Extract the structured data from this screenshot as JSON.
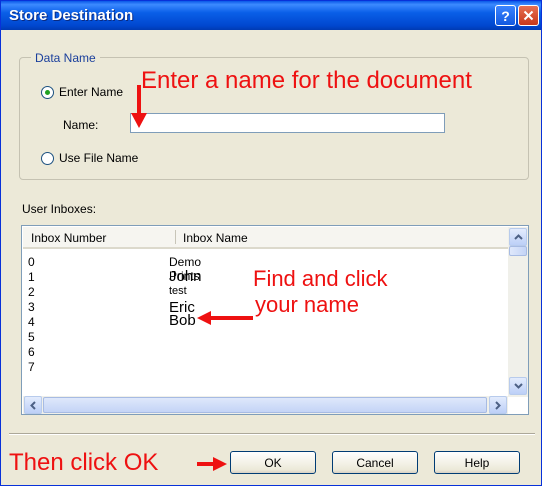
{
  "window": {
    "title": "Store Destination",
    "help_glyph": "?",
    "close_glyph": "✕"
  },
  "data_name": {
    "legend": "Data Name",
    "enter_name_label": "Enter Name",
    "name_label": "Name:",
    "name_value": "",
    "use_file_name_label": "Use File Name"
  },
  "inboxes": {
    "label": "User Inboxes:",
    "col_number": "Inbox Number",
    "col_name": "Inbox Name",
    "rows": [
      {
        "number": "0",
        "name": "Demo Prints"
      },
      {
        "number": "1",
        "name": "John"
      },
      {
        "number": "2",
        "name": "test"
      },
      {
        "number": "3",
        "name": "Eric"
      },
      {
        "number": "4",
        "name": "Bob"
      },
      {
        "number": "5",
        "name": ""
      },
      {
        "number": "6",
        "name": ""
      },
      {
        "number": "7",
        "name": ""
      }
    ]
  },
  "buttons": {
    "ok": "OK",
    "cancel": "Cancel",
    "help": "Help"
  },
  "annotations": {
    "enter_name": "Enter a name for the document",
    "find_line1": "Find and click",
    "find_line2": "your name",
    "then_ok": "Then click OK",
    "color": "#ee1111"
  }
}
